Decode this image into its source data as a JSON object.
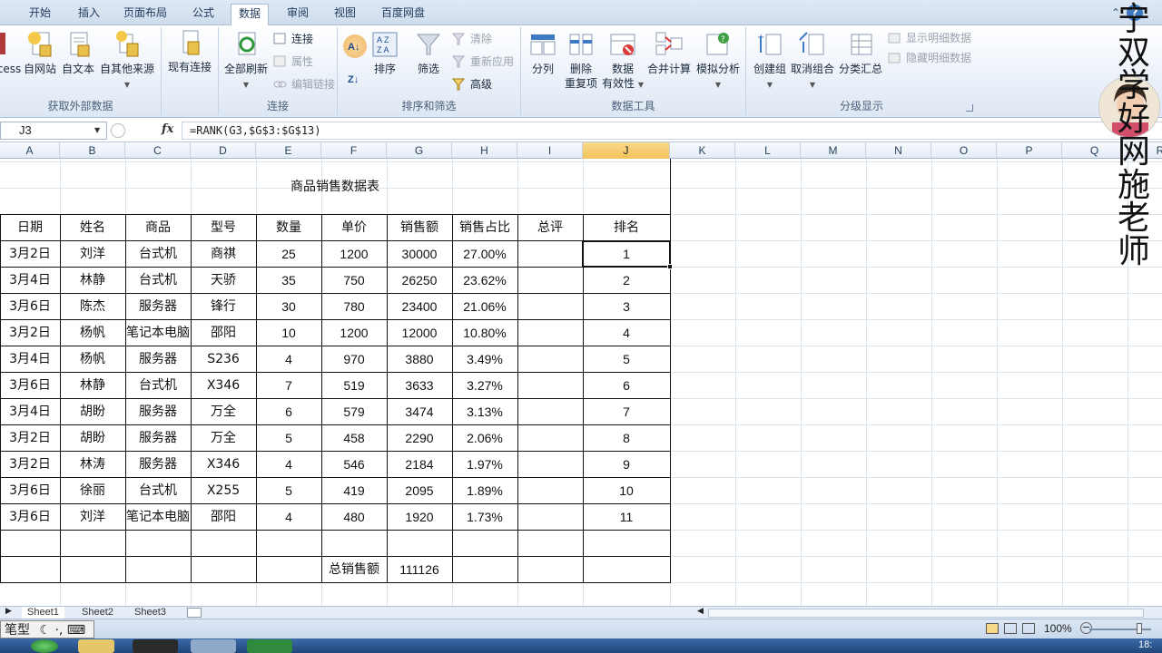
{
  "ribbon_tabs": [
    "开始",
    "插入",
    "页面布局",
    "公式",
    "数据",
    "审阅",
    "视图",
    "百度网盘"
  ],
  "active_tab": "数据",
  "ribbon": {
    "external_data": {
      "label": "获取外部数据",
      "access": "cess",
      "web": "自网站",
      "text": "自文本",
      "other": "自其他来源"
    },
    "existing_connections": "现有连接",
    "connections": {
      "label": "连接",
      "refresh_all": "全部刷新",
      "connections": "连接",
      "properties": "属性",
      "edit_links": "编辑链接"
    },
    "sort_filter": {
      "label": "排序和筛选",
      "sort": "排序",
      "filter": "筛选",
      "clear": "清除",
      "reapply": "重新应用",
      "advanced": "高级"
    },
    "data_tools": {
      "label": "数据工具",
      "text_to_columns": "分列",
      "remove_dup_1": "删除",
      "remove_dup_2": "重复项",
      "validation_1": "数据",
      "validation_2": "有效性",
      "consolidate": "合并计算",
      "what_if": "模拟分析"
    },
    "outline": {
      "label": "分级显示",
      "group": "创建组",
      "ungroup": "取消组合",
      "subtotal": "分类汇总",
      "show_detail": "显示明细数据",
      "hide_detail": "隐藏明细数据"
    }
  },
  "formula_bar": {
    "name_box": "J3",
    "fx": "fx",
    "formula": "=RANK(G3,$G$3:$G$13)"
  },
  "columns": [
    "A",
    "B",
    "C",
    "D",
    "E",
    "F",
    "G",
    "H",
    "I",
    "J",
    "K",
    "L",
    "M",
    "N",
    "O",
    "P",
    "Q",
    "R"
  ],
  "selected_column": "J",
  "table": {
    "title": "商品销售数据表",
    "headers": [
      "日期",
      "姓名",
      "商品",
      "型号",
      "数量",
      "单价",
      "销售额",
      "销售占比",
      "总评",
      "排名"
    ],
    "rows": [
      [
        "3月2日",
        "刘洋",
        "台式机",
        "商祺",
        "25",
        "1200",
        "30000",
        "27.00%",
        "",
        "1"
      ],
      [
        "3月4日",
        "林静",
        "台式机",
        "天骄",
        "35",
        "750",
        "26250",
        "23.62%",
        "",
        "2"
      ],
      [
        "3月6日",
        "陈杰",
        "服务器",
        "锋行",
        "30",
        "780",
        "23400",
        "21.06%",
        "",
        "3"
      ],
      [
        "3月2日",
        "杨帆",
        "笔记本电脑",
        "邵阳",
        "10",
        "1200",
        "12000",
        "10.80%",
        "",
        "4"
      ],
      [
        "3月4日",
        "杨帆",
        "服务器",
        "S236",
        "4",
        "970",
        "3880",
        "3.49%",
        "",
        "5"
      ],
      [
        "3月6日",
        "林静",
        "台式机",
        "X346",
        "7",
        "519",
        "3633",
        "3.27%",
        "",
        "6"
      ],
      [
        "3月4日",
        "胡盼",
        "服务器",
        "万全",
        "6",
        "579",
        "3474",
        "3.13%",
        "",
        "7"
      ],
      [
        "3月2日",
        "胡盼",
        "服务器",
        "万全",
        "5",
        "458",
        "2290",
        "2.06%",
        "",
        "8"
      ],
      [
        "3月2日",
        "林涛",
        "服务器",
        "X346",
        "4",
        "546",
        "2184",
        "1.97%",
        "",
        "9"
      ],
      [
        "3月6日",
        "徐丽",
        "台式机",
        "X255",
        "5",
        "419",
        "2095",
        "1.89%",
        "",
        "10"
      ],
      [
        "3月6日",
        "刘洋",
        "笔记本电脑",
        "邵阳",
        "4",
        "480",
        "1920",
        "1.73%",
        "",
        "11"
      ]
    ],
    "total_label": "总销售额",
    "total_value": "111126"
  },
  "watermark": "宁双学好网施老师",
  "sheet_tabs": [
    "Sheet1",
    "Sheet2",
    "Sheet3"
  ],
  "status": {
    "ime": "笔型",
    "zoom": "100%"
  },
  "clock": "18:"
}
